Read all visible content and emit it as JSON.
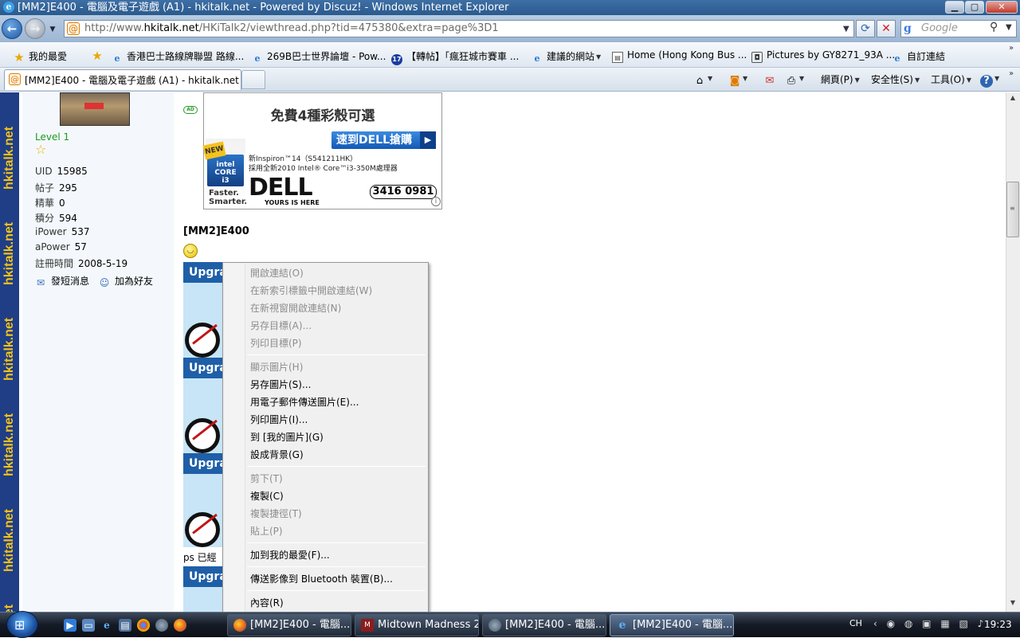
{
  "window": {
    "title": "[MM2]E400 - 電腦及電子遊戲 (A1) - hkitalk.net - Powered by Discuz! - Windows Internet Explorer",
    "icon": "ie-icon"
  },
  "address_bar": {
    "url_prefix": "http://www.",
    "url_domain": "hkitalk.net",
    "url_path": "/HKiTalk2/viewthread.php?tid=475380&extra=page%3D1",
    "search_placeholder": "Google"
  },
  "favorites_bar": {
    "favorites_label": "我的最愛",
    "items": [
      {
        "label": "香港巴士路線牌聯盟 路線...",
        "icon": "ie-icon"
      },
      {
        "label": "269B巴士世界論壇 - Pow...",
        "icon": "ie-icon"
      },
      {
        "label": "【轉帖】「瘋狂城市賽車 ...",
        "icon": "17-icon"
      },
      {
        "label": "建議的網站",
        "icon": "ie-icon"
      },
      {
        "label": "Home (Hong Kong Bus ...",
        "icon": "doc-icon"
      },
      {
        "label": "Pictures by GY8271_93A ...",
        "icon": "camera-icon"
      },
      {
        "label": "自訂連結",
        "icon": "ie-icon"
      }
    ]
  },
  "tabs": {
    "active_title": "[MM2]E400 - 電腦及電子遊戲 (A1) - hkitalk.net ..."
  },
  "command_bar": {
    "page_label": "網頁(P)",
    "safety_label": "安全性(S)",
    "tools_label": "工具(O)"
  },
  "watermark": "hkitalk.net",
  "profile": {
    "level": "Level 1",
    "stats": [
      {
        "key": "UID",
        "value": "15985"
      },
      {
        "key": "帖子",
        "value": "295"
      },
      {
        "key": "精華",
        "value": "0"
      },
      {
        "key": "積分",
        "value": "594"
      },
      {
        "key": "iPower",
        "value": "537"
      },
      {
        "key": "aPower",
        "value": "57"
      },
      {
        "key": "註冊時間",
        "value": "2008-5-19"
      }
    ],
    "pm_label": "發短消息",
    "add_friend_label": "加為好友"
  },
  "ad": {
    "tag": "AD",
    "headline": "免費4種彩殼可選",
    "cta": "速到DELL搶購",
    "intel_new": "NEW",
    "intel_line1": "intel",
    "intel_line2": "CORE",
    "intel_line3": "i3",
    "intel_slogan1": "Faster.",
    "intel_slogan2": "Smarter.",
    "desc_line1": "新Inspiron™14（S541211HK）",
    "desc_line2": "採用全新2010 Intel® Core™i3-350M處理器",
    "brand": "DELL",
    "brand_tagline": "YOURS IS HERE",
    "phone": "3416 0981"
  },
  "post": {
    "title": "[MM2]E400",
    "upgrade_label": "Upgra",
    "ps_text": "ps 已經"
  },
  "context_menu": {
    "groups": [
      [
        {
          "label": "開啟連結(O)",
          "enabled": false
        },
        {
          "label": "在新索引標籤中開啟連結(W)",
          "enabled": false
        },
        {
          "label": "在新視窗開啟連結(N)",
          "enabled": false
        },
        {
          "label": "另存目標(A)...",
          "enabled": false
        },
        {
          "label": "列印目標(P)",
          "enabled": false
        }
      ],
      [
        {
          "label": "顯示圖片(H)",
          "enabled": false
        },
        {
          "label": "另存圖片(S)...",
          "enabled": true
        },
        {
          "label": "用電子郵件傳送圖片(E)...",
          "enabled": true
        },
        {
          "label": "列印圖片(I)...",
          "enabled": true
        },
        {
          "label": "到 [我的圖片](G)",
          "enabled": true
        },
        {
          "label": "設成背景(G)",
          "enabled": true
        }
      ],
      [
        {
          "label": "剪下(T)",
          "enabled": false
        },
        {
          "label": "複製(C)",
          "enabled": true
        },
        {
          "label": "複製捷徑(T)",
          "enabled": false
        },
        {
          "label": "貼上(P)",
          "enabled": false
        }
      ],
      [
        {
          "label": "加到我的最愛(F)...",
          "enabled": true
        }
      ],
      [
        {
          "label": "傳送影像到 Bluetooth 裝置(B)...",
          "enabled": true
        }
      ],
      [
        {
          "label": "內容(R)",
          "enabled": true
        }
      ]
    ]
  },
  "taskbar": {
    "tasks": [
      {
        "label": "[MM2]E400 - 電腦...",
        "icon": "firefox-icon",
        "active": false
      },
      {
        "label": "Midtown Madness 2",
        "icon": "game-icon",
        "active": false
      },
      {
        "label": "[MM2]E400 - 電腦...",
        "icon": "chrome-icon",
        "active": false
      },
      {
        "label": "[MM2]E400 - 電腦...",
        "icon": "ie-icon",
        "active": true
      }
    ],
    "lang": "CH",
    "clock": "19:23"
  },
  "colors": {
    "title_bar": "#2b5a8d",
    "watermark_bg": "#1f3e86",
    "watermark_text": "#f4c21c",
    "upgrade_bar": "#1f5fa8",
    "level_green": "#1d9a1d"
  }
}
